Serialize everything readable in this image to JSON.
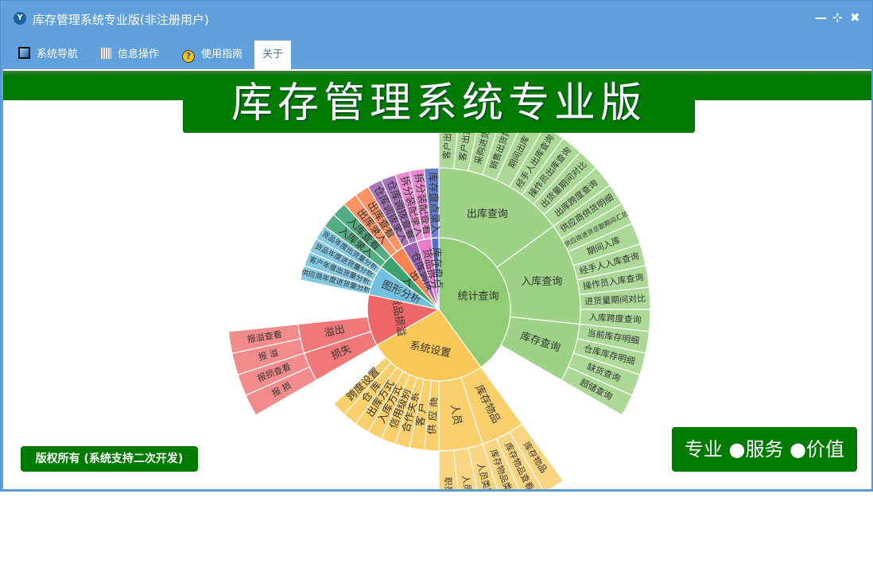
{
  "window": {
    "title": "库存管理系统专业版(非注册用户)",
    "app_icon": "yf-logo-icon",
    "controls": [
      "minimize-icon",
      "restore-icon",
      "close-icon"
    ]
  },
  "menu": [
    {
      "label": "系统导航",
      "icon": "monitor-icon"
    },
    {
      "label": "信息操作",
      "icon": "grid-icon"
    },
    {
      "label": "使用指南",
      "icon": "help-icon"
    },
    {
      "label": "关于",
      "active": true
    }
  ],
  "banner": {
    "title": "库存管理系统专业版"
  },
  "footer": {
    "copyright": "版权所有 (系统支持二次开发)",
    "slogan": "专业 ●服务 ●价值"
  },
  "colors": {
    "titlebar": "#5fa0dd",
    "brand_green": "#007a00"
  },
  "chart_data": {
    "type": "sunburst",
    "unit_note": "each leaf value = 1",
    "nodes": [
      {
        "name": "统计查询",
        "value": 24,
        "color": "#91cc75",
        "children": [
          {
            "name": "出库查询",
            "children": [
              "客户出货排行",
              "客户出货总额",
              "采购进货排行",
              "销售出货排行",
              "期间出库",
              "经手人出库查询",
              "操作员出库查询",
              "出货量期间对比",
              "出库跨度查询"
            ]
          },
          {
            "name": "入库查询",
            "children": [
              "供应商供货明细",
              "供应商进货总额期间汇总",
              "期间入库",
              "经手人入库查询",
              "操作员入库查询",
              "进货量期间对比",
              "入库跨度查询"
            ]
          },
          {
            "name": "库存查询",
            "children": [
              "当前库存明细",
              "仓库库存明细",
              "缺货查询",
              "超储查询"
            ]
          }
        ]
      },
      {
        "name": "系统设置",
        "value": 16,
        "color": "#fac858",
        "children": [
          {
            "name": "库存物品",
            "children": [
              "库存物品",
              "库存物品查看",
              "库存物品类别"
            ]
          },
          {
            "name": "人员",
            "children": [
              "人员类别",
              "人员",
              "职员"
            ]
          },
          {
            "name": "供 应 商"
          },
          {
            "name": "客  户"
          },
          {
            "name": "合作关系"
          },
          {
            "name": "信用级别"
          },
          {
            "name": "入库方式"
          },
          {
            "name": "出库方式"
          },
          {
            "name": "仓  库"
          },
          {
            "name": "跨度设置"
          }
        ]
      },
      {
        "name": "货品损溢",
        "value": 7,
        "color": "#ee6666",
        "children": [
          {
            "name": "损失",
            "children": [
              "报  损",
              "报损查看"
            ]
          },
          {
            "name": "溢出",
            "children": [
              "报  溢",
              "报溢查看"
            ]
          }
        ]
      },
      {
        "name": "图形分析",
        "color": "#73c0de",
        "children": [
          {
            "name": "供应商年度进货量分析"
          },
          {
            "name": "客户年度出货量分析"
          },
          {
            "name": "货品年度进货量分析"
          },
          {
            "name": "货品年度出货量分析"
          }
        ]
      },
      {
        "name": "入",
        "color": "#3ba272",
        "children": [
          {
            "name": "入库录入"
          },
          {
            "name": "入库查看"
          }
        ]
      },
      {
        "name": "出",
        "color": "#fc8452",
        "children": [
          {
            "name": "出库录入"
          },
          {
            "name": "出库查看"
          }
        ]
      },
      {
        "name": "仓库调拨",
        "color": "#9a60b4",
        "children": [
          {
            "name": "仓库调拨录入"
          },
          {
            "name": "仓库调拨查看"
          }
        ]
      },
      {
        "name": "货品拆分",
        "color": "#ea7ccc",
        "children": [
          {
            "name": "拆分装配录入"
          },
          {
            "name": "拆分装配查看"
          }
        ]
      },
      {
        "name": "库存盘点",
        "color": "#5470c6",
        "children": [
          {
            "name": "库存盘点录入"
          }
        ]
      }
    ]
  }
}
